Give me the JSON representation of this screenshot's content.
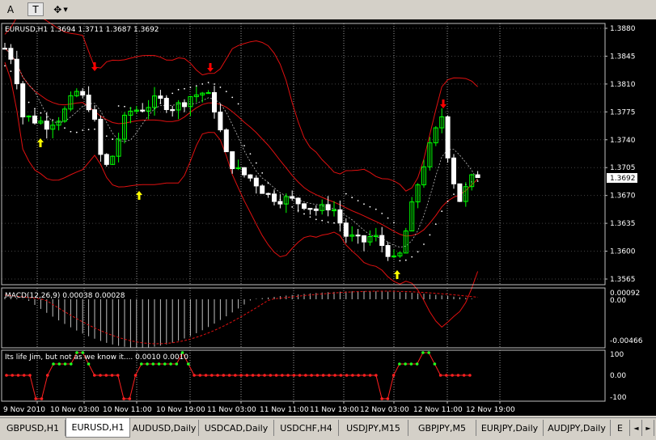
{
  "toolbar": {
    "text_tool": "A",
    "label_tool": "T",
    "arrows_tool": "✥"
  },
  "chart": {
    "main_label": "EURUSD,H1  1.3694 1.3711 1.3687 1.3692",
    "macd_label": "MACD(12,26,9) 0.00038 0.00028",
    "jim_label": "Its life Jim, but not as we know it....  0.0010 0.0010",
    "price_ticks": [
      "1.3880",
      "1.3845",
      "1.3810",
      "1.3775",
      "1.3740",
      "1.3705",
      "1.3670",
      "1.3635",
      "1.3600",
      "1.3565"
    ],
    "current_price": "1.3692",
    "macd_ticks": [
      "0.00092",
      "0.00",
      "-0.00466"
    ],
    "jim_ticks": [
      "100",
      "0.00",
      "-100"
    ],
    "time_ticks": [
      "9 Nov 2010",
      "10 Nov 03:00",
      "10 Nov 11:00",
      "10 Nov 19:00",
      "11 Nov 03:00",
      "11 Nov 11:00",
      "11 Nov 19:00",
      "12 Nov 03:00",
      "12 Nov 11:00",
      "12 Nov 19:00"
    ],
    "colors": {
      "background": "#000000",
      "bull_candle": "#00ff00",
      "bear_candle": "#ffffff",
      "bands": "#e01010",
      "sar": "#ffffff",
      "up_arrow": "#ffff00",
      "down_arrow": "#ff0000",
      "grid": "#c0c0c0"
    }
  },
  "tabs": [
    {
      "label": "GBPUSD,H1",
      "active": false
    },
    {
      "label": "EURUSD,H1",
      "active": true
    },
    {
      "label": "AUDUSD,Daily",
      "active": false
    },
    {
      "label": "USDCAD,Daily",
      "active": false
    },
    {
      "label": "USDCHF,H4",
      "active": false
    },
    {
      "label": "USDJPY,M15",
      "active": false
    },
    {
      "label": "GBPJPY,M5",
      "active": false
    },
    {
      "label": "EURJPY,Daily",
      "active": false
    },
    {
      "label": "AUDJPY,Daily",
      "active": false
    },
    {
      "label": "E",
      "active": false
    }
  ],
  "tab_scroll": {
    "left": "◄",
    "right": "►"
  }
}
